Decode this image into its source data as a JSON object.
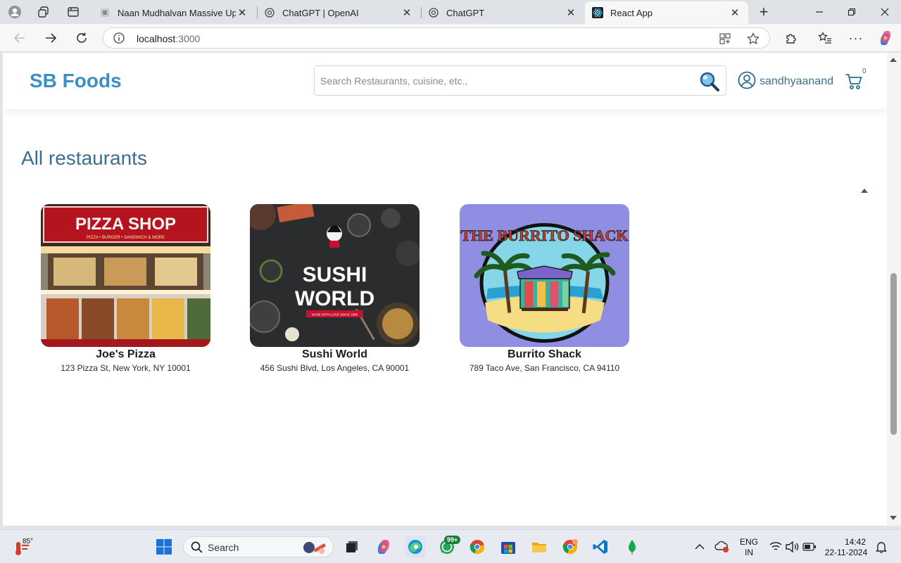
{
  "browser": {
    "tabs": [
      {
        "title": "Naan Mudhalvan Massive Upskill",
        "active": false
      },
      {
        "title": "ChatGPT | OpenAI",
        "active": false
      },
      {
        "title": "ChatGPT",
        "active": false
      },
      {
        "title": "React App",
        "active": true
      }
    ],
    "new_tab": "+",
    "url_host": "localhost",
    "url_port": ":3000"
  },
  "site": {
    "brand": "SB Foods",
    "search_placeholder": "Search Restaurants, cuisine, etc.,",
    "user_name": "sandhyaanand",
    "cart_count": "0"
  },
  "main": {
    "section_title": "All restaurants",
    "restaurants": [
      {
        "name": "Joe's Pizza",
        "address": "123 Pizza St, New York, NY 10001",
        "sign_text": "PIZZA SHOP",
        "sub_sign": "PIZZA • BURGER • SANDWICH & MORE"
      },
      {
        "name": "Sushi World",
        "address": "456 Sushi Blvd, Los Angeles, CA 90001",
        "logo_line1": "SUSHI",
        "logo_line2": "WORLD",
        "tagline": "MADE WITH LOVE SINCE 1990"
      },
      {
        "name": "Burrito Shack",
        "address": "789 Taco Ave, San Francisco, CA 94110",
        "logo_text": "THE BURRITO SHACK"
      }
    ]
  },
  "taskbar": {
    "weather": "85°",
    "search_label": "Search",
    "whatsapp_badge": "99+",
    "lang_top": "ENG",
    "lang_bottom": "IN",
    "time": "14:42",
    "date": "22-11-2024"
  }
}
